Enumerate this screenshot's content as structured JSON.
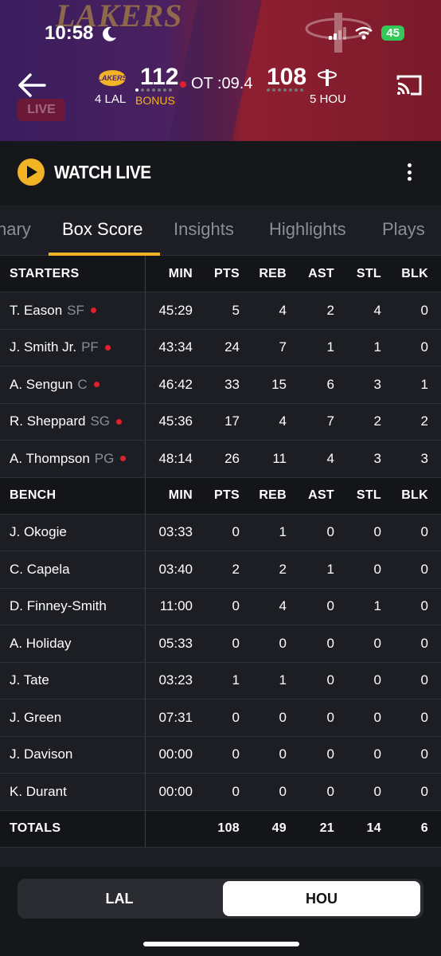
{
  "status_bar": {
    "time": "10:58",
    "battery": "45"
  },
  "header": {
    "live_label": "LIVE",
    "away": {
      "abbr_with_seed": "4 LAL",
      "score": "112",
      "bonus": "BONUS",
      "logo_text": "LAKERS",
      "timeouts_remaining": 1
    },
    "home": {
      "abbr_with_seed": "5 HOU",
      "score": "108",
      "timeouts_remaining": 0
    },
    "game_clock": "OT :09.4"
  },
  "watch_bar": {
    "label": "WATCH LIVE"
  },
  "tabs": [
    {
      "label": "nary"
    },
    {
      "label": "Box Score",
      "active": true
    },
    {
      "label": "Insights"
    },
    {
      "label": "Highlights"
    },
    {
      "label": "Plays"
    }
  ],
  "columns": [
    "MIN",
    "PTS",
    "REB",
    "AST",
    "STL",
    "BLK"
  ],
  "starters": {
    "title": "STARTERS",
    "rows": [
      {
        "name": "T. Eason",
        "pos": "SF",
        "on_court": true,
        "stats": [
          "45:29",
          "5",
          "4",
          "2",
          "4",
          "0"
        ]
      },
      {
        "name": "J. Smith Jr.",
        "pos": "PF",
        "on_court": true,
        "stats": [
          "43:34",
          "24",
          "7",
          "1",
          "1",
          "0"
        ]
      },
      {
        "name": "A. Sengun",
        "pos": "C",
        "on_court": true,
        "stats": [
          "46:42",
          "33",
          "15",
          "6",
          "3",
          "1"
        ]
      },
      {
        "name": "R. Sheppard",
        "pos": "SG",
        "on_court": true,
        "stats": [
          "45:36",
          "17",
          "4",
          "7",
          "2",
          "2"
        ]
      },
      {
        "name": "A. Thompson",
        "pos": "PG",
        "on_court": true,
        "stats": [
          "48:14",
          "26",
          "11",
          "4",
          "3",
          "3"
        ]
      }
    ]
  },
  "bench": {
    "title": "BENCH",
    "rows": [
      {
        "name": "J. Okogie",
        "pos": "",
        "on_court": false,
        "stats": [
          "03:33",
          "0",
          "1",
          "0",
          "0",
          "0"
        ]
      },
      {
        "name": "C. Capela",
        "pos": "",
        "on_court": false,
        "stats": [
          "03:40",
          "2",
          "2",
          "1",
          "0",
          "0"
        ]
      },
      {
        "name": "D. Finney-Smith",
        "pos": "",
        "on_court": false,
        "stats": [
          "11:00",
          "0",
          "4",
          "0",
          "1",
          "0"
        ]
      },
      {
        "name": "A. Holiday",
        "pos": "",
        "on_court": false,
        "stats": [
          "05:33",
          "0",
          "0",
          "0",
          "0",
          "0"
        ]
      },
      {
        "name": "J. Tate",
        "pos": "",
        "on_court": false,
        "stats": [
          "03:23",
          "1",
          "1",
          "0",
          "0",
          "0"
        ]
      },
      {
        "name": "J. Green",
        "pos": "",
        "on_court": false,
        "stats": [
          "07:31",
          "0",
          "0",
          "0",
          "0",
          "0"
        ]
      },
      {
        "name": "J. Davison",
        "pos": "",
        "on_court": false,
        "stats": [
          "00:00",
          "0",
          "0",
          "0",
          "0",
          "0"
        ]
      },
      {
        "name": "K. Durant",
        "pos": "",
        "on_court": false,
        "stats": [
          "00:00",
          "0",
          "0",
          "0",
          "0",
          "0"
        ]
      }
    ]
  },
  "totals": {
    "label": "TOTALS",
    "stats": [
      "",
      "108",
      "49",
      "21",
      "14",
      "6"
    ]
  },
  "team_toggle": {
    "away": "LAL",
    "home": "HOU",
    "selected": "HOU"
  },
  "colors": {
    "accent": "#f2b325",
    "live_red": "#e0202d",
    "bg": "#1c1e23"
  }
}
